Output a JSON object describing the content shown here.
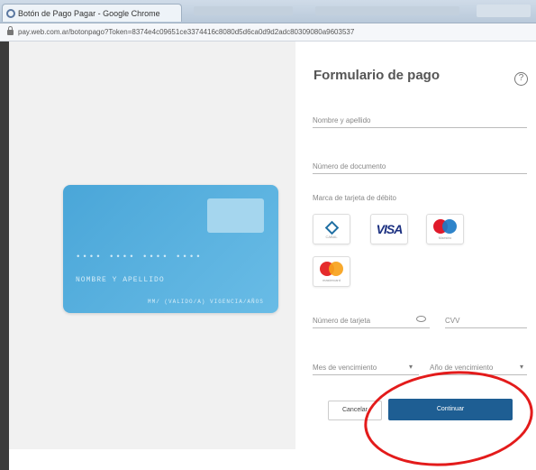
{
  "browser": {
    "tab_title": "Botón de Pago Pagar - Google Chrome",
    "url": "pay.web.com.ar/botonpago?Token=8374e4c09651ce3374416c8080d5d6ca0d9d2adc80309080a9603537"
  },
  "card_preview": {
    "number": "•••• •••• •••• ••••",
    "holder": "NOMBRE Y APELLIDO",
    "expiry": "MM/ (VALIDO/A) VIGENCIA/AÑOS"
  },
  "form": {
    "title": "Formulario de pago",
    "help_symbol": "?",
    "name_placeholder": "Nombre y apellido",
    "document_placeholder": "Número de documento",
    "brand_label": "Marca de tarjeta de débito",
    "brands": {
      "cabal": "CABAL",
      "visa": "VISA",
      "maestro": "Maestro",
      "mastercard": "mastercard"
    },
    "card_number_placeholder": "Número de tarjeta",
    "cvv_placeholder": "CVV",
    "month_placeholder": "Mes de vencimiento",
    "year_placeholder": "Año de vencimiento",
    "select_arrow": "▾",
    "cancel_label": "Cancelar",
    "continue_label": "Continuar"
  },
  "colors": {
    "card_blue": "#55afdf",
    "primary_button": "#1e5e93",
    "annotation_red": "#e31b1b"
  }
}
